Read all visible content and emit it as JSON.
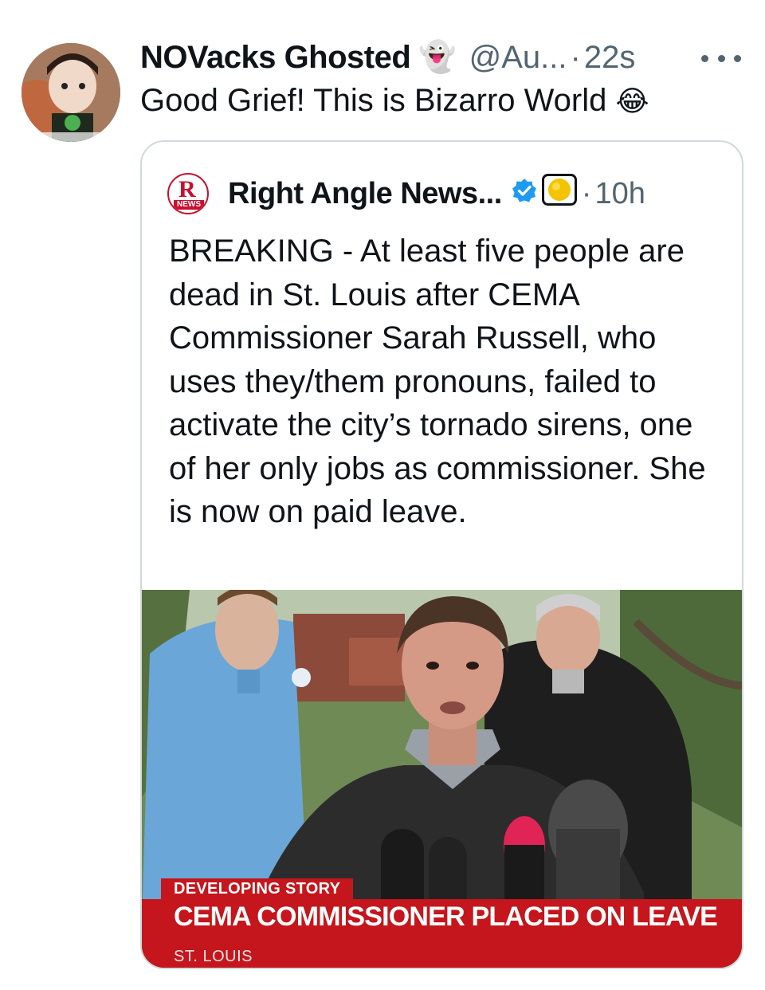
{
  "tweet": {
    "display_name": "NOVacks Ghosted",
    "name_emoji": "👻",
    "handle": "@Au...",
    "separator": "·",
    "time": "22s",
    "text": "Good Grief!  This is Bizarro World",
    "text_emoji": "😂",
    "more_icon": "ellipsis-icon",
    "avatar_icon": "avatar-photo"
  },
  "quoted": {
    "logo_letter": "R",
    "logo_caption": "NEWS",
    "display_name": "Right Angle News...",
    "verified_icon": "verified-badge-icon",
    "org_icon": "yellow-circle-icon",
    "separator": "·",
    "time": "10h",
    "text": "BREAKING - At least five people are dead in St. Louis after CEMA Commissioner Sarah Russell, who uses they/them pronouns, failed to activate the city’s tornado sirens, one of her only jobs as commissioner. She is now on paid leave.",
    "media": {
      "lower_third_tag": "DEVELOPING STORY",
      "headline": "CEMA COMMISSIONER PLACED ON LEAVE",
      "location": "ST. LOUIS"
    }
  },
  "colors": {
    "text_primary": "#0f1419",
    "text_secondary": "#536471",
    "border": "#cfd9de",
    "verified_blue": "#1d9bf0",
    "news_red": "#c4161c"
  }
}
